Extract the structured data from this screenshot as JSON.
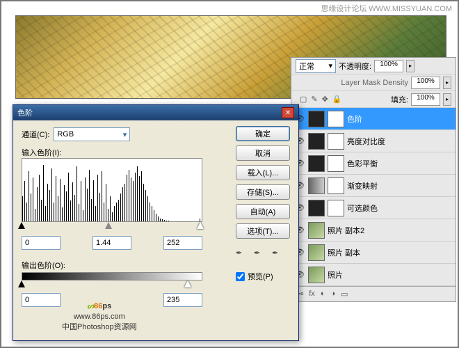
{
  "header": {
    "site": "思缘设计论坛",
    "url": "WWW.MISSYUAN.COM"
  },
  "layers_panel": {
    "blend_mode": "正常",
    "opacity_label": "不透明度:",
    "opacity_value": "100%",
    "density_label": "Layer Mask Density",
    "density_value": "100%",
    "fill_label": "填充:",
    "fill_value": "100%",
    "layers": [
      {
        "name": "色阶",
        "selected": true
      },
      {
        "name": "亮度对比度",
        "selected": false
      },
      {
        "name": "色彩平衡",
        "selected": false
      },
      {
        "name": "渐变映射",
        "selected": false
      },
      {
        "name": "可选颜色",
        "selected": false
      },
      {
        "name": "照片 副本2",
        "selected": false
      },
      {
        "name": "照片 副本",
        "selected": false
      },
      {
        "name": "照片",
        "selected": false
      }
    ]
  },
  "dialog": {
    "title": "色阶",
    "channel_label": "通道(C):",
    "channel_value": "RGB",
    "input_levels_label": "输入色阶(I):",
    "output_levels_label": "输出色阶(O):",
    "shadow": "0",
    "midtone": "1.44",
    "highlight": "252",
    "out_shadow": "0",
    "out_highlight": "235",
    "buttons": {
      "ok": "确定",
      "cancel": "取消",
      "load": "载入(L)...",
      "save": "存储(S)...",
      "auto": "自动(A)",
      "options": "选项(T)..."
    },
    "preview_label": "预览(P)"
  },
  "watermark": {
    "logo1": "86",
    "logo2": "ps",
    "url": "www.86ps.com",
    "tagline": "中国Photoshop资源网"
  }
}
